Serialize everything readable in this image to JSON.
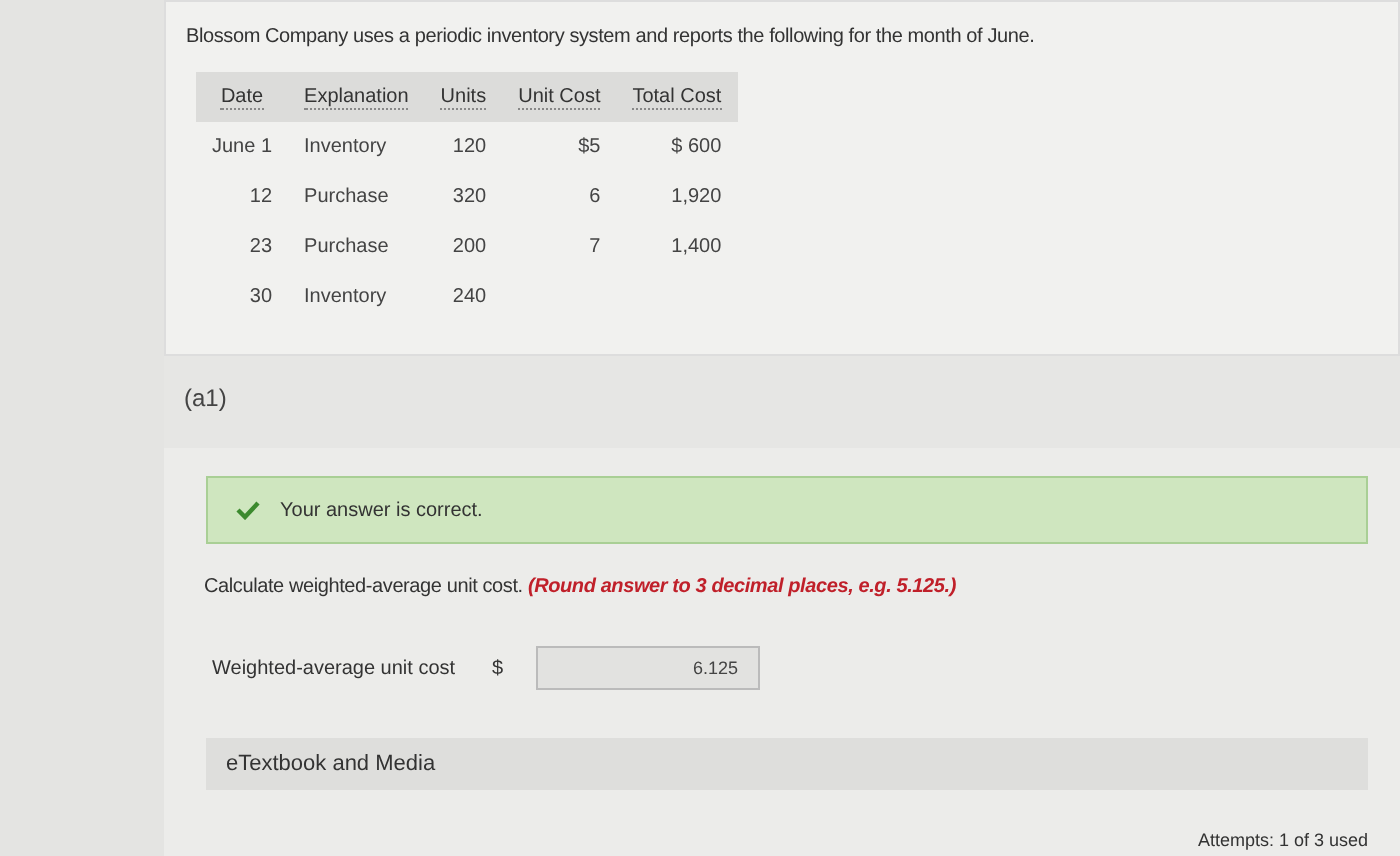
{
  "intro": "Blossom Company uses a periodic inventory system and reports the following for the month of June.",
  "table": {
    "columns": [
      "Date",
      "Explanation",
      "Units",
      "Unit Cost",
      "Total Cost"
    ],
    "rows": [
      [
        "June 1",
        "Inventory",
        "120",
        "$5",
        "$ 600"
      ],
      [
        "12",
        "Purchase",
        "320",
        "6",
        "1,920"
      ],
      [
        "23",
        "Purchase",
        "200",
        "7",
        "1,400"
      ],
      [
        "30",
        "Inventory",
        "240",
        "",
        ""
      ]
    ]
  },
  "part_label": "(a1)",
  "feedback": {
    "correct": true,
    "text": "Your answer is correct."
  },
  "question": {
    "text": "Calculate weighted-average unit cost.",
    "hint": "(Round answer to 3 decimal places, e.g. 5.125.)"
  },
  "answer": {
    "label": "Weighted-average unit cost",
    "currency": "$",
    "value": "6.125"
  },
  "resources": "eTextbook and Media",
  "attempts": "Attempts: 1 of 3 used"
}
